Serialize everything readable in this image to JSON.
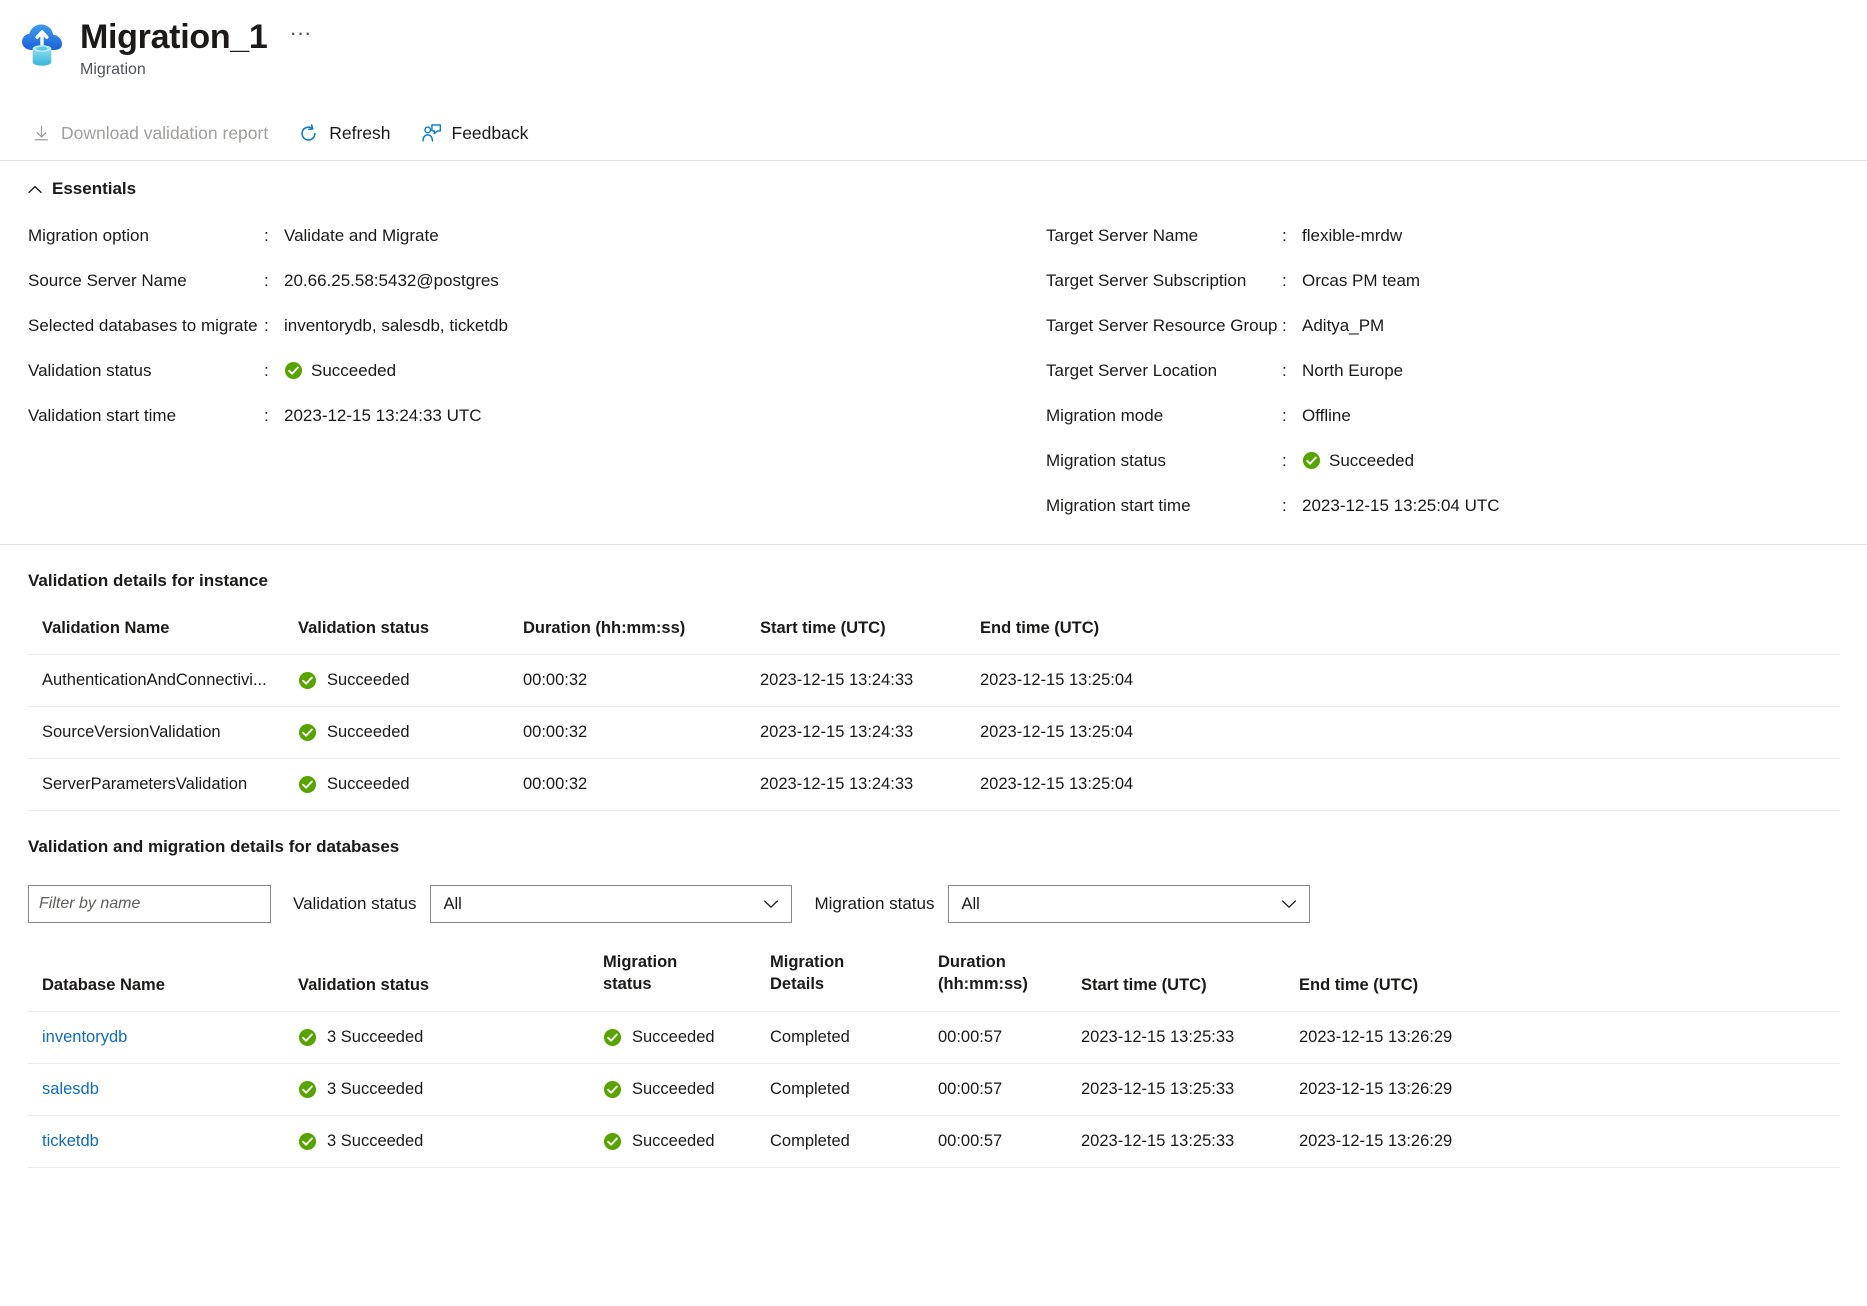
{
  "header": {
    "icon": "cloud-database-migration-icon",
    "title": "Migration_1",
    "subtitle": "Migration",
    "more_label": "···"
  },
  "commandbar": {
    "items": [
      {
        "label": "Download validation report",
        "icon": "download-icon",
        "disabled": true
      },
      {
        "label": "Refresh",
        "icon": "refresh-icon",
        "disabled": false
      },
      {
        "label": "Feedback",
        "icon": "feedback-icon",
        "disabled": false
      }
    ]
  },
  "essentials": {
    "title": "Essentials",
    "chevron": "chevron-up-icon",
    "left": [
      {
        "label": "Migration option",
        "value": "Validate and Migrate"
      },
      {
        "label": "Source Server Name",
        "value": "20.66.25.58:5432@postgres"
      },
      {
        "label": "Selected databases to migrate",
        "value": "inventorydb, salesdb, ticketdb"
      },
      {
        "label": "Validation status",
        "value": "Succeeded",
        "status": "success"
      },
      {
        "label": "Validation start time",
        "value": "2023-12-15 13:24:33 UTC"
      }
    ],
    "right": [
      {
        "label": "Target Server Name",
        "value": "flexible-mrdw"
      },
      {
        "label": "Target Server Subscription",
        "value": "Orcas PM team"
      },
      {
        "label": "Target Server Resource Group",
        "value": "Aditya_PM"
      },
      {
        "label": "Target Server Location",
        "value": "North Europe"
      },
      {
        "label": "Migration mode",
        "value": "Offline"
      },
      {
        "label": "Migration status",
        "value": "Succeeded",
        "status": "success"
      },
      {
        "label": "Migration start time",
        "value": "2023-12-15 13:25:04 UTC"
      }
    ]
  },
  "validation_instance": {
    "title": "Validation details for instance",
    "columns": [
      "Validation Name",
      "Validation status",
      "Duration (hh:mm:ss)",
      "Start time (UTC)",
      "End time (UTC)"
    ],
    "rows": [
      {
        "name": "AuthenticationAndConnectivi...",
        "status": "Succeeded",
        "duration": "00:00:32",
        "start": "2023-12-15 13:24:33",
        "end": "2023-12-15 13:25:04"
      },
      {
        "name": "SourceVersionValidation",
        "status": "Succeeded",
        "duration": "00:00:32",
        "start": "2023-12-15 13:24:33",
        "end": "2023-12-15 13:25:04"
      },
      {
        "name": "ServerParametersValidation",
        "status": "Succeeded",
        "duration": "00:00:32",
        "start": "2023-12-15 13:24:33",
        "end": "2023-12-15 13:25:04"
      }
    ]
  },
  "databases": {
    "title": "Validation and migration details for databases",
    "filter": {
      "placeholder": "Filter by name",
      "value": "",
      "validation_status_label": "Validation status",
      "validation_status_value": "All",
      "migration_status_label": "Migration status",
      "migration_status_value": "All"
    },
    "columns": [
      "Database Name",
      "Validation status",
      "Migration status",
      "Migration Details",
      "Duration (hh:mm:ss)",
      "Start time (UTC)",
      "End time (UTC)"
    ],
    "columns_wrapped": [
      {
        "line1": "Migration",
        "line2": "status"
      },
      {
        "line1": "Migration",
        "line2": "Details"
      },
      {
        "line1": "Duration",
        "line2": "(hh:mm:ss)"
      }
    ],
    "rows": [
      {
        "name": "inventorydb",
        "validation_status": "3 Succeeded",
        "migration_status": "Succeeded",
        "migration_details": "Completed",
        "duration": "00:00:57",
        "start": "2023-12-15 13:25:33",
        "end": "2023-12-15 13:26:29"
      },
      {
        "name": "salesdb",
        "validation_status": "3 Succeeded",
        "migration_status": "Succeeded",
        "migration_details": "Completed",
        "duration": "00:00:57",
        "start": "2023-12-15 13:25:33",
        "end": "2023-12-15 13:26:29"
      },
      {
        "name": "ticketdb",
        "validation_status": "3 Succeeded",
        "migration_status": "Succeeded",
        "migration_details": "Completed",
        "duration": "00:00:57",
        "start": "2023-12-15 13:25:33",
        "end": "2023-12-15 13:26:29"
      }
    ]
  },
  "colors": {
    "success_green": "#57a300",
    "link_blue": "#0f6cbd",
    "icon_blue": "#0078d4",
    "disabled_gray": "#a19f9d",
    "border_gray": "#e1dfdd"
  }
}
